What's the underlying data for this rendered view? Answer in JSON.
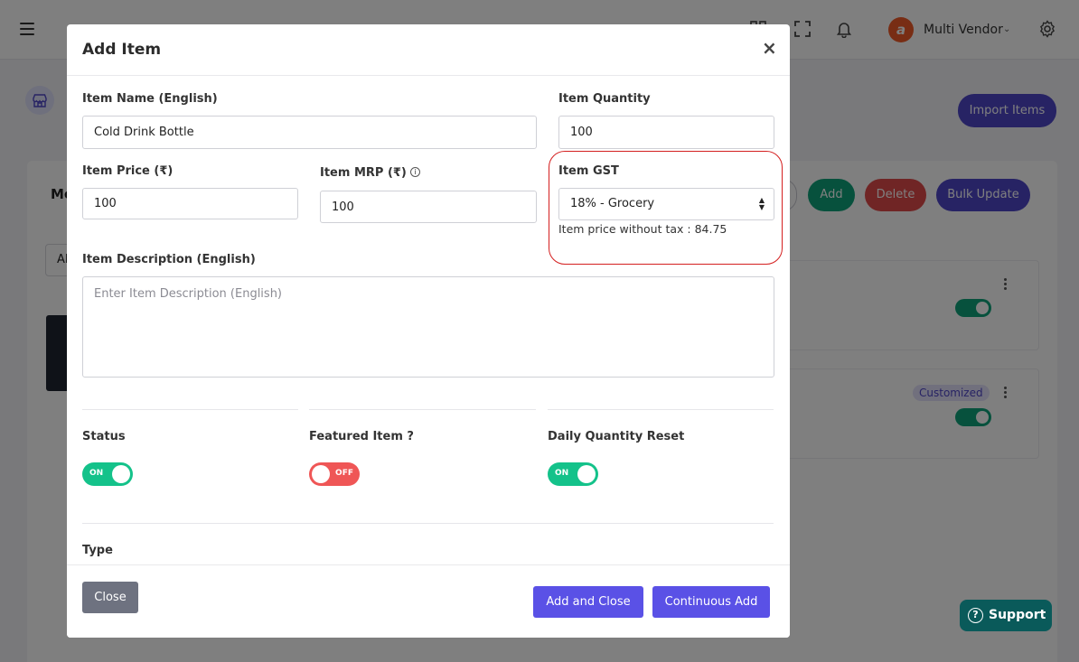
{
  "background": {
    "vendor_name": "Multi Vendor",
    "vendor_avatar_letter": "a",
    "import_button": "Import Items",
    "card_title": "Me",
    "filter_select_value": "Al",
    "actions": {
      "add": "Add",
      "delete": "Delete",
      "bulk_update": "Bulk Update"
    },
    "customized_badge": "Customized",
    "support_button": "Support"
  },
  "modal": {
    "title": "Add Item",
    "close_symbol": "×",
    "fields": {
      "item_name_label": "Item Name (English)",
      "item_name_value": "Cold Drink Bottle",
      "item_quantity_label": "Item Quantity",
      "item_quantity_value": "100",
      "item_price_label": "Item Price (₹)",
      "item_price_value": "100",
      "item_mrp_label": "Item MRP (₹)",
      "item_mrp_value": "100",
      "item_gst_label": "Item GST",
      "item_gst_value": "18% - Grocery",
      "price_without_tax": "Item price without tax : 84.75",
      "description_label": "Item Description (English)",
      "description_placeholder": "Enter Item Description (English)"
    },
    "toggles": {
      "status_label": "Status",
      "status_text": "ON",
      "featured_label": "Featured Item ?",
      "featured_text": "OFF",
      "daily_reset_label": "Daily Quantity Reset",
      "daily_reset_text": "ON"
    },
    "type_label": "Type",
    "footer": {
      "close": "Close",
      "add_and_close": "Add and Close",
      "continuous_add": "Continuous Add"
    }
  },
  "colors": {
    "primary": "#5a51e6",
    "toggle_on": "#14c28a",
    "toggle_off": "#ef5656",
    "highlight": "#d41f1f",
    "support": "#0a5a5a"
  }
}
